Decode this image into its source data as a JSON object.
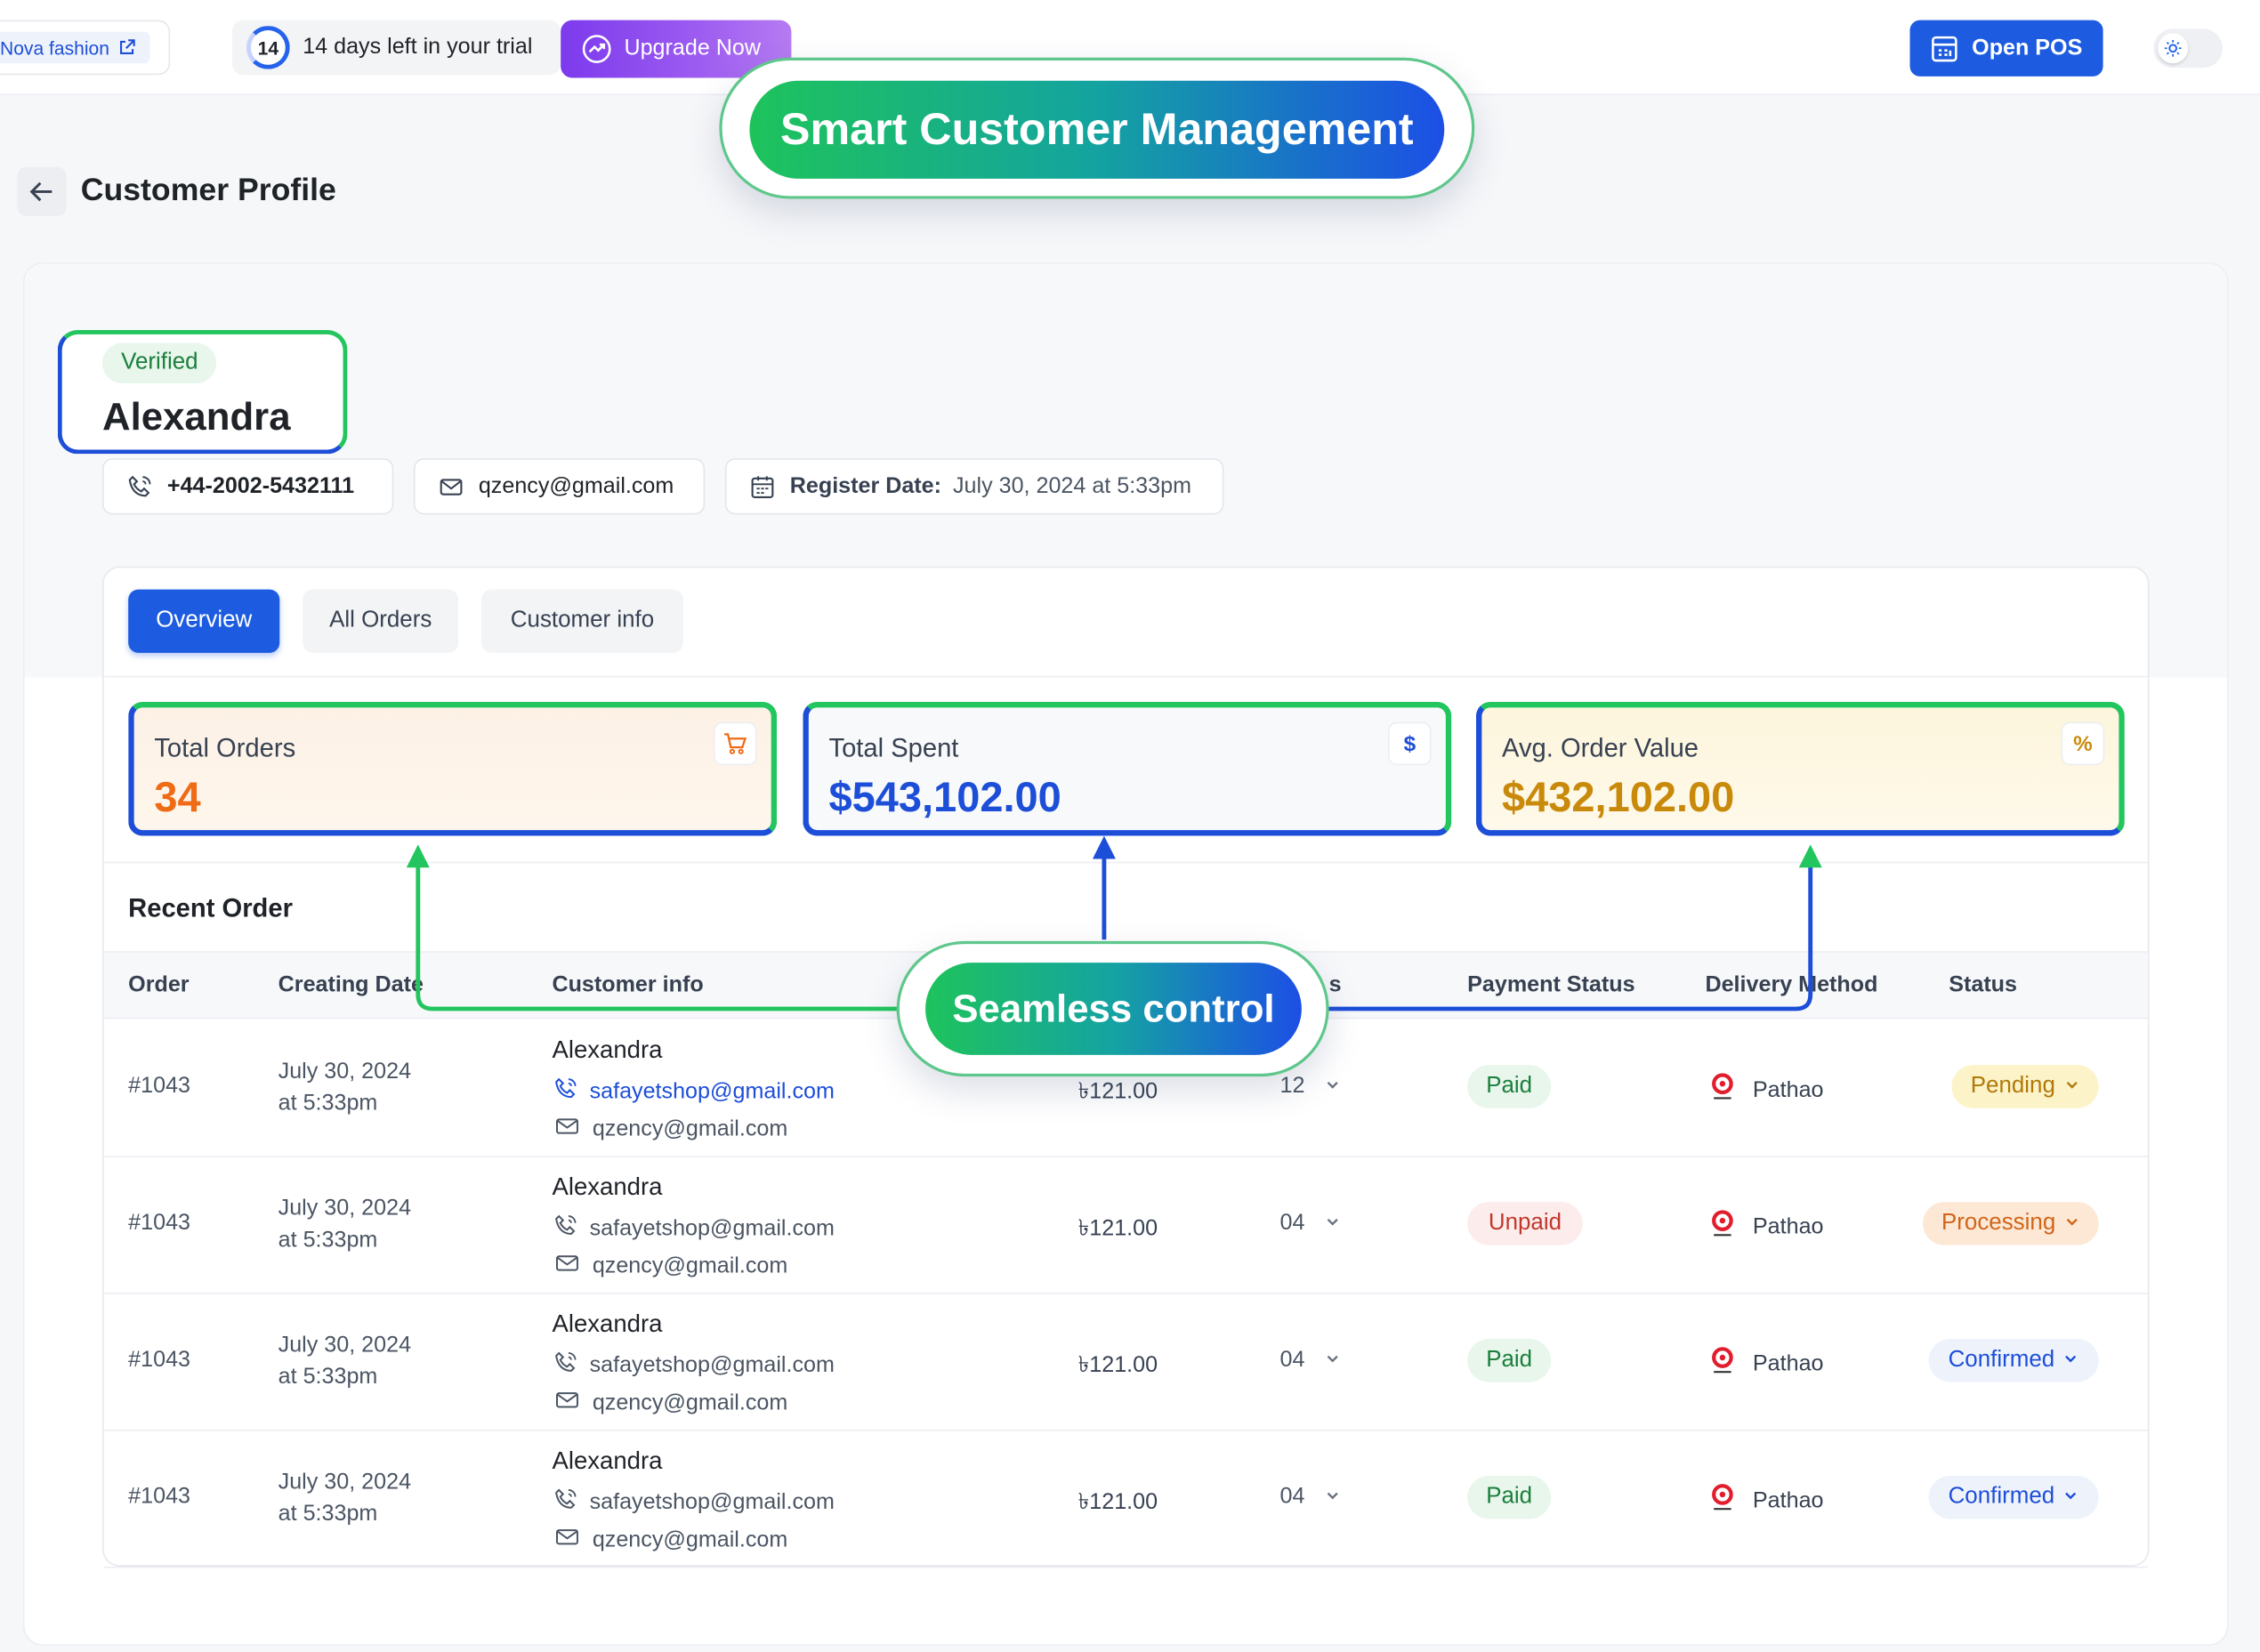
{
  "topbar": {
    "store_name": "Nova fashion",
    "trial_days": "14",
    "trial_text": "14 days left in your trial",
    "upgrade_label": "Upgrade Now",
    "open_pos_label": "Open POS"
  },
  "header": {
    "title": "Customer Profile"
  },
  "callouts": {
    "smart": "Smart Customer Management",
    "seamless": "Seamless control"
  },
  "customer": {
    "verified": "Verified",
    "name": "Alexandra",
    "phone": "+44-2002-5432111",
    "email": "qzency@gmail.com",
    "register_label": "Register Date:",
    "register_value": "July 30, 2024 at 5:33pm"
  },
  "tabs": [
    {
      "label": "Overview",
      "active": true
    },
    {
      "label": "All Orders",
      "active": false
    },
    {
      "label": "Customer info",
      "active": false
    }
  ],
  "stats": [
    {
      "label": "Total Orders",
      "value": "34",
      "icon": "cart-icon",
      "color": "#ef6b16"
    },
    {
      "label": "Total Spent",
      "value": "$543,102.00",
      "icon": "dollar-icon",
      "color": "#1d4ed8"
    },
    {
      "label": "Avg. Order Value",
      "value": "$432,102.00",
      "icon": "percent-icon",
      "color": "#c98a0b"
    }
  ],
  "recent": {
    "title": "Recent Order",
    "columns": [
      "Order",
      "Creating Date",
      "Customer info",
      "s",
      "Payment Status",
      "Delivery Method",
      "Status"
    ],
    "rows": [
      {
        "order": "#1043",
        "date": "July 30, 2024",
        "time": "at 5:33pm",
        "name": "Alexandra",
        "email1": "safayetshop@gmail.com",
        "email2": "qzency@gmail.com",
        "amount": "৳121.00",
        "qty": "12",
        "payment": "Paid",
        "delivery": "Pathao",
        "status": "Pending"
      },
      {
        "order": "#1043",
        "date": "July 30, 2024",
        "time": "at 5:33pm",
        "name": "Alexandra",
        "email1": "safayetshop@gmail.com",
        "email2": "qzency@gmail.com",
        "amount": "৳121.00",
        "qty": "04",
        "payment": "Unpaid",
        "delivery": "Pathao",
        "status": "Processing"
      },
      {
        "order": "#1043",
        "date": "July 30, 2024",
        "time": "at 5:33pm",
        "name": "Alexandra",
        "email1": "safayetshop@gmail.com",
        "email2": "qzency@gmail.com",
        "amount": "৳121.00",
        "qty": "04",
        "payment": "Paid",
        "delivery": "Pathao",
        "status": "Confirmed"
      },
      {
        "order": "#1043",
        "date": "July 30, 2024",
        "time": "at 5:33pm",
        "name": "Alexandra",
        "email1": "safayetshop@gmail.com",
        "email2": "qzency@gmail.com",
        "amount": "৳121.00",
        "qty": "04",
        "payment": "Paid",
        "delivery": "Pathao",
        "status": "Confirmed"
      }
    ]
  },
  "colors": {
    "primary": "#1d5ce0",
    "upgrade": "#8b46ee",
    "highlight_green": "#22c55e",
    "highlight_blue": "#1d4ed8"
  }
}
